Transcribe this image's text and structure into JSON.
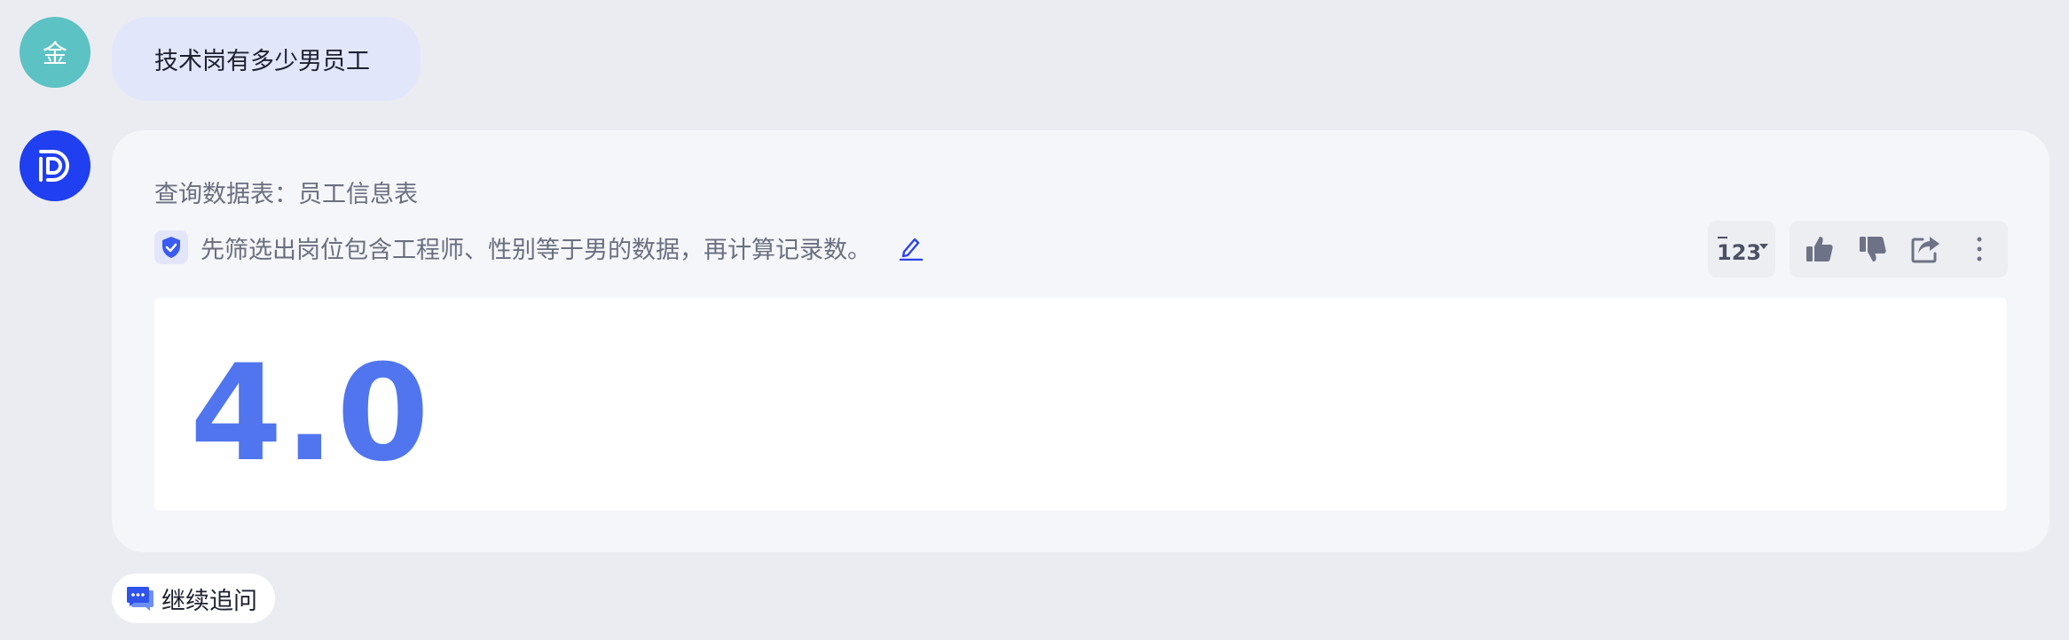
{
  "user": {
    "avatar_text": "金",
    "avatar_color": "#5cc2c3",
    "question": "技术岗有多少男员工"
  },
  "assistant": {
    "avatar_icon": "bot-logo-icon",
    "avatar_color": "#1f3ff0",
    "table_line": "查询数据表：员工信息表",
    "plan_icon": "shield-check-icon",
    "plan_text": "先筛选出岗位包含工程师、性别等于男的数据，再计算记录数。",
    "edit_icon": "pencil-icon",
    "format_button": {
      "label": "123",
      "icon": "number-format-icon"
    },
    "actions": [
      {
        "name": "like",
        "icon": "thumbs-up-icon"
      },
      {
        "name": "dislike",
        "icon": "thumbs-down-icon"
      },
      {
        "name": "share",
        "icon": "share-icon"
      },
      {
        "name": "more",
        "icon": "more-vertical-icon"
      }
    ],
    "result_value": "4.0",
    "result_color": "#5075ee"
  },
  "followup": {
    "label": "继续追问",
    "icon": "chat-bubbles-icon"
  },
  "colors": {
    "background": "#ebecf1",
    "accent": "#1f3ff0",
    "bubble": "#e2e6fb"
  }
}
